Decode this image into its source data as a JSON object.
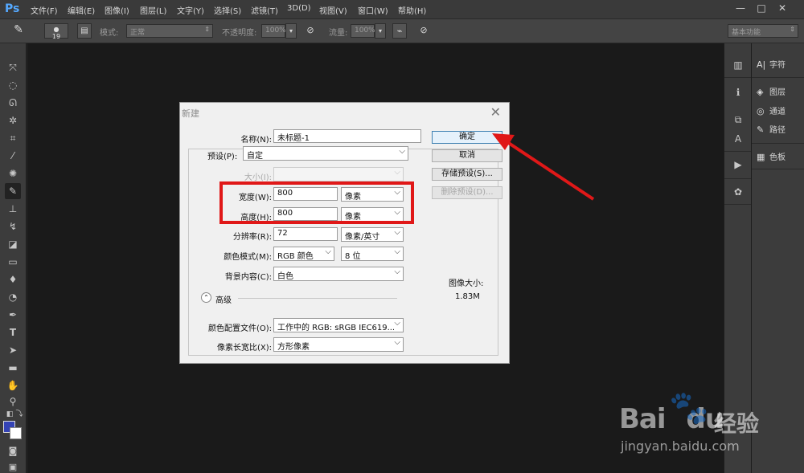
{
  "app": {
    "logo": "Ps"
  },
  "menu": [
    "文件(F)",
    "编辑(E)",
    "图像(I)",
    "图层(L)",
    "文字(Y)",
    "选择(S)",
    "滤镜(T)",
    "3D(D)",
    "视图(V)",
    "窗口(W)",
    "帮助(H)"
  ],
  "window_controls": {
    "minimize": "—",
    "maximize": "□",
    "close": "✕"
  },
  "options": {
    "brush_size": "19",
    "mode_label": "模式:",
    "mode_value": "正常",
    "opacity_label": "不透明度:",
    "opacity_value": "100%",
    "flow_label": "流量:",
    "flow_value": "100%",
    "workspace": "基本功能"
  },
  "right_panel": {
    "items": [
      {
        "icon": "A|",
        "label": "字符"
      },
      {
        "icon": "◈",
        "label": "图层"
      },
      {
        "icon": "◎",
        "label": "通道"
      },
      {
        "icon": "✎",
        "label": "路径"
      },
      {
        "icon": "▦",
        "label": "色板"
      }
    ]
  },
  "dialog": {
    "title": "新建",
    "name_label": "名称(N):",
    "name_value": "未标题-1",
    "preset_label": "预设(P):",
    "preset_value": "自定",
    "size_label": "大小(I):",
    "size_value": "",
    "width_label": "宽度(W):",
    "width_value": "800",
    "width_unit": "像素",
    "height_label": "高度(H):",
    "height_value": "800",
    "height_unit": "像素",
    "resolution_label": "分辨率(R):",
    "resolution_value": "72",
    "resolution_unit": "像素/英寸",
    "color_mode_label": "颜色模式(M):",
    "color_mode_value": "RGB 颜色",
    "bit_depth_value": "8 位",
    "background_label": "背景内容(C):",
    "background_value": "白色",
    "advanced_label": "高级",
    "color_profile_label": "颜色配置文件(O):",
    "color_profile_value": "工作中的 RGB: sRGB IEC619...",
    "pixel_aspect_label": "像素长宽比(X):",
    "pixel_aspect_value": "方形像素",
    "buttons": {
      "ok": "确定",
      "cancel": "取消",
      "save_preset": "存储预设(S)...",
      "delete_preset": "删除预设(D)..."
    },
    "image_size_label": "图像大小:",
    "image_size_value": "1.83M"
  },
  "annotation_color": "#e01818",
  "watermark": {
    "logo": "Bai",
    "logo2": "du",
    "cn": "经验",
    "url": "jingyan.baidu.com"
  }
}
